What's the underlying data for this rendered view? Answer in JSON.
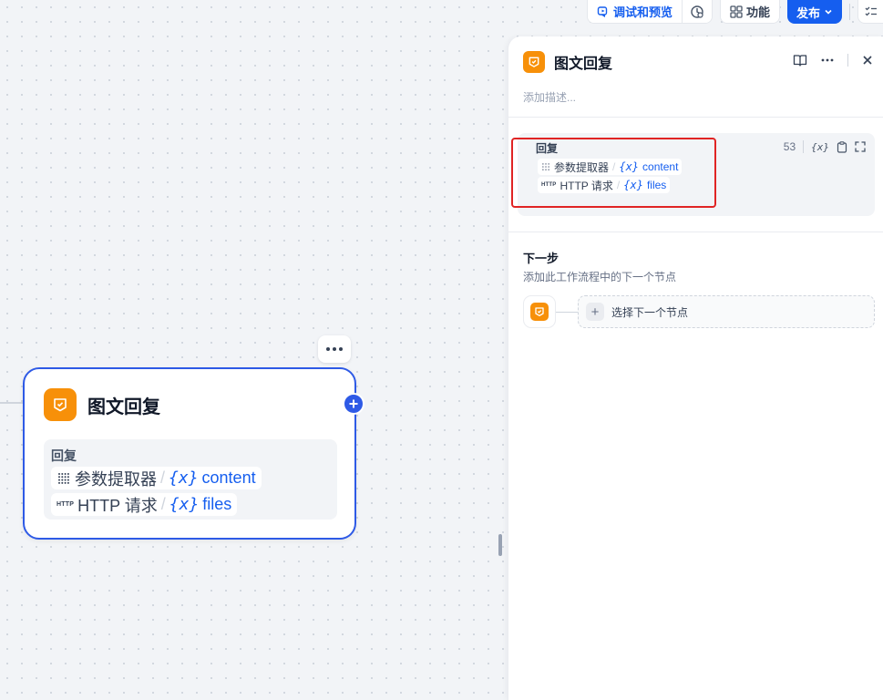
{
  "toolbar": {
    "debug_label": "调试和预览",
    "features_label": "功能",
    "publish_label": "发布"
  },
  "canvas_node": {
    "title": "图文回复",
    "reply_label": "回复",
    "vars": [
      {
        "source": "参数提取器",
        "name": "content"
      },
      {
        "source": "HTTP 请求",
        "name": "files"
      }
    ]
  },
  "panel": {
    "title": "图文回复",
    "description_placeholder": "添加描述...",
    "reply": {
      "label": "回复",
      "count": "53",
      "vars": [
        {
          "source": "参数提取器",
          "name": "content"
        },
        {
          "source": "HTTP 请求",
          "name": "files"
        }
      ]
    },
    "next_step": {
      "title": "下一步",
      "description": "添加此工作流程中的下一个节点",
      "select_label": "选择下一个节点"
    }
  },
  "http_tag": "HTTP",
  "var_icon_text": "{x}",
  "colors": {
    "accent": "#155eef",
    "node_border": "#2e5ae6",
    "node_icon": "#f79009",
    "highlight": "#e02424"
  }
}
